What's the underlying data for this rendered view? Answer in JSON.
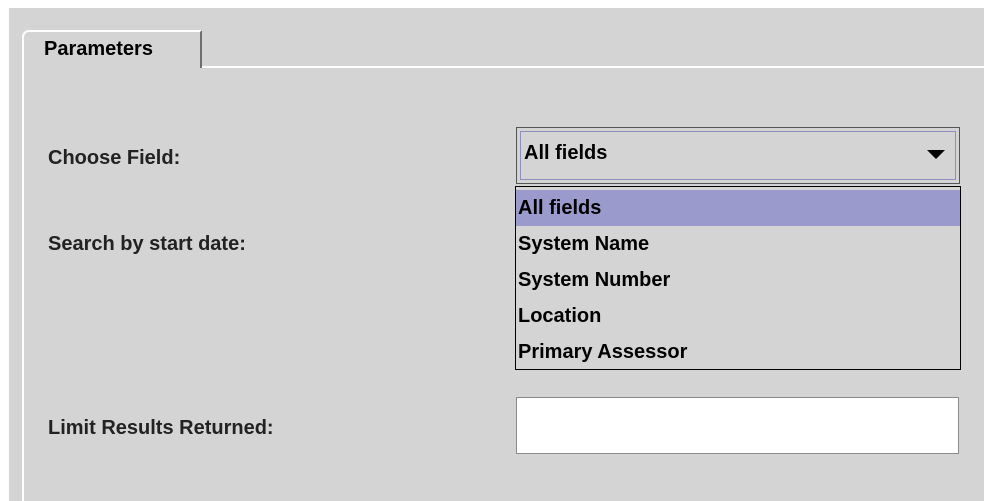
{
  "tabs": [
    {
      "label": "Parameters"
    }
  ],
  "form": {
    "choose_field_label": "Choose Field:",
    "start_date_label": "Search by start date:",
    "limit_label": "Limit Results Returned:",
    "choose_field_value": "All fields",
    "limit_value": ""
  },
  "dropdown": {
    "options": [
      "All fields",
      "System Name",
      "System Number",
      "Location",
      "Primary Assessor"
    ],
    "selected": "All fields"
  },
  "colors": {
    "panel": "#d4d4d4",
    "selection": "#9a9acc"
  },
  "icons": {
    "combo_arrow": "triangle-down-icon"
  }
}
